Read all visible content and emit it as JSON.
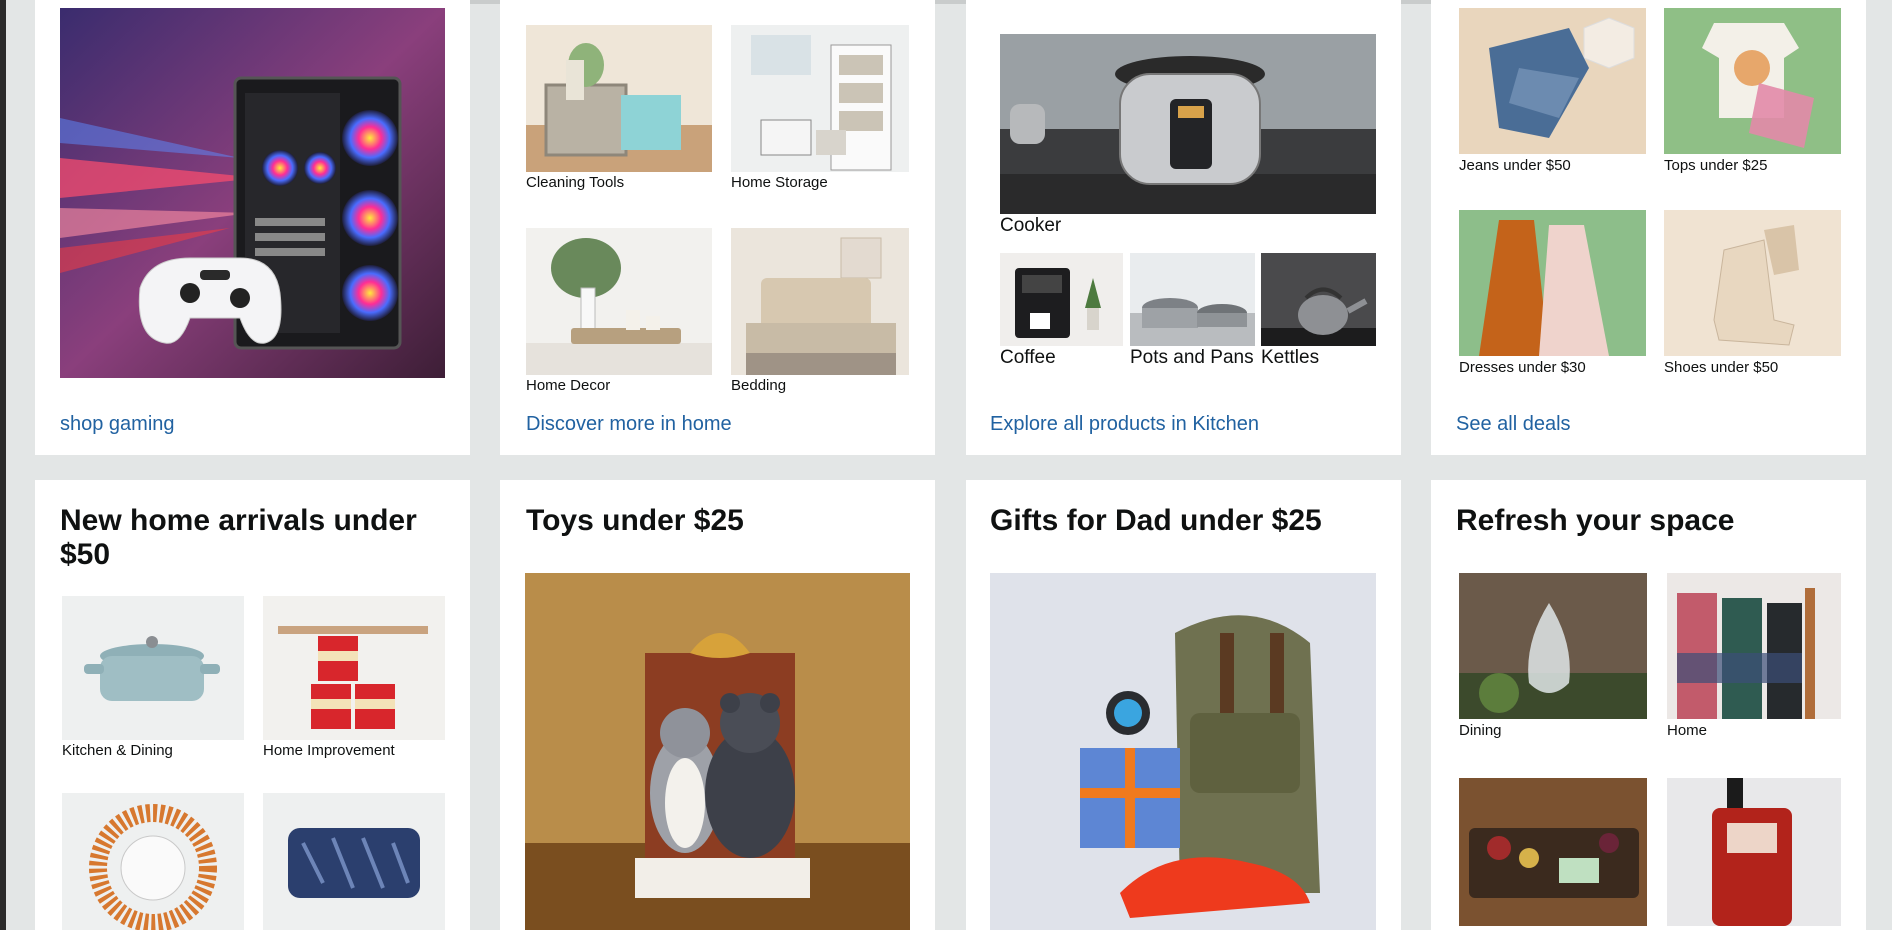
{
  "row1": {
    "gaming": {
      "link": "shop gaming"
    },
    "home": {
      "items": [
        {
          "label": "Cleaning Tools"
        },
        {
          "label": "Home Storage"
        },
        {
          "label": "Home Decor"
        },
        {
          "label": "Bedding"
        }
      ],
      "link": "Discover more in home"
    },
    "kitchen": {
      "main_label": "Cooker",
      "items": [
        {
          "label": "Coffee"
        },
        {
          "label": "Pots and Pans"
        },
        {
          "label": "Kettles"
        }
      ],
      "link": "Explore all products in Kitchen"
    },
    "deals": {
      "items": [
        {
          "label": "Jeans under $50"
        },
        {
          "label": "Tops under $25"
        },
        {
          "label": "Dresses under $30"
        },
        {
          "label": "Shoes under $50"
        }
      ],
      "link": "See all deals"
    }
  },
  "row2": {
    "new_home": {
      "title": "New home arrivals under $50",
      "items": [
        {
          "label": "Kitchen & Dining"
        },
        {
          "label": "Home Improvement"
        }
      ]
    },
    "toys": {
      "title": "Toys under $25"
    },
    "dad": {
      "title": "Gifts for Dad under $25"
    },
    "refresh": {
      "title": "Refresh your space",
      "items": [
        {
          "label": "Dining"
        },
        {
          "label": "Home"
        }
      ]
    }
  },
  "colors": {
    "link": "#2162a1",
    "background": "#e3e6e6",
    "card": "#ffffff"
  }
}
